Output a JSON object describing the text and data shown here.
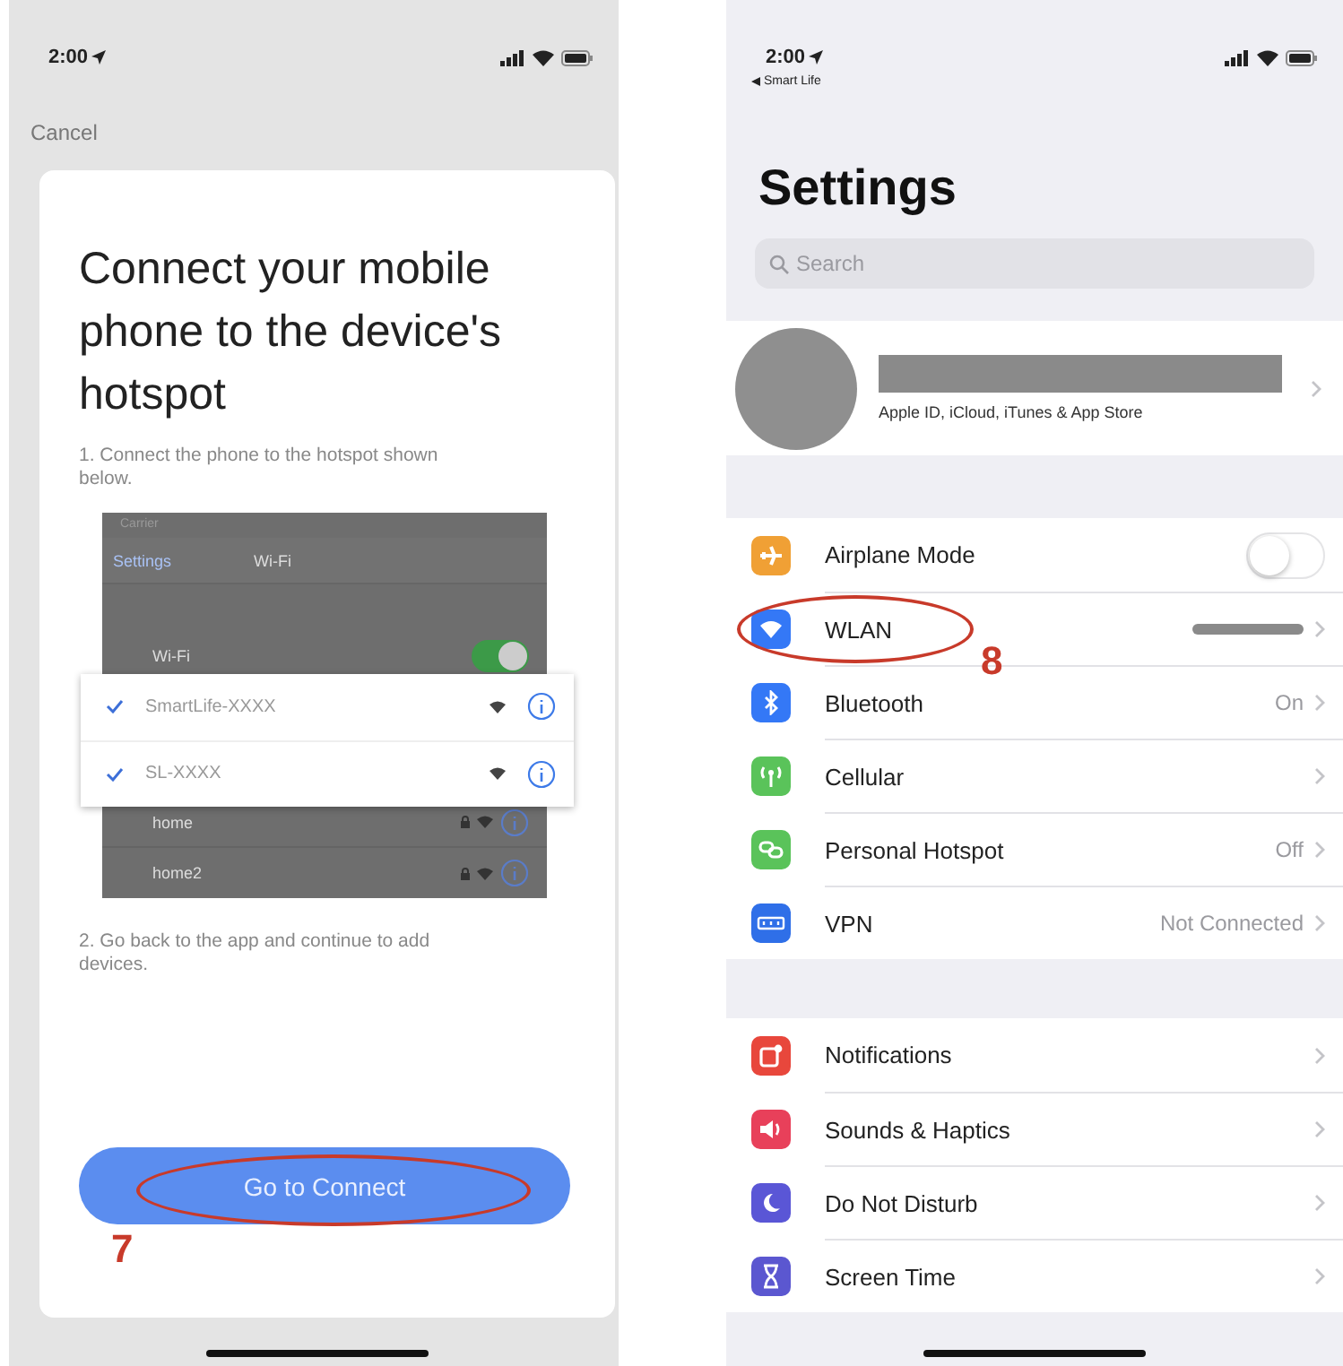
{
  "left_screen": {
    "status_bar": {
      "time": "2:00"
    },
    "cancel": "Cancel",
    "title": "Connect your mobile phone to the device's hotspot",
    "step_1": "1. Connect the phone to the hotspot shown below.",
    "wifi_example": {
      "carrier": "Carrier",
      "back": "Settings",
      "title": "Wi-Fi",
      "wifi_label": "Wi-Fi",
      "wifi_on": true,
      "highlighted_networks": [
        {
          "name": "SmartLife-XXXX",
          "checked": true
        },
        {
          "name": "SL-XXXX",
          "checked": true
        }
      ],
      "other_networks": [
        {
          "name": "home",
          "locked": true
        },
        {
          "name": "home2",
          "locked": true
        }
      ]
    },
    "step_2": "2. Go back to the app and continue to add devices.",
    "button": {
      "label": "Go to Connect",
      "annotation": "7"
    }
  },
  "right_screen": {
    "status_bar": {
      "time": "2:00",
      "back_app": "Smart Life"
    },
    "title": "Settings",
    "search": {
      "placeholder": "Search"
    },
    "profile": {
      "subtitle": "Apple ID, iCloud, iTunes & App Store"
    },
    "groups": [
      {
        "rows": [
          {
            "label": "Airplane Mode",
            "kind": "toggle",
            "on": false,
            "color": "#f0a035"
          },
          {
            "label": "WLAN",
            "kind": "masked",
            "color": "#3478f6",
            "annotation": "8"
          },
          {
            "label": "Bluetooth",
            "kind": "value",
            "value": "On",
            "color": "#3478f6"
          },
          {
            "label": "Cellular",
            "kind": "link",
            "color": "#5ac35a"
          },
          {
            "label": "Personal Hotspot",
            "kind": "value",
            "value": "Off",
            "color": "#5ac35a"
          },
          {
            "label": "VPN",
            "kind": "value",
            "value": "Not Connected",
            "color": "#2f6fe8"
          }
        ]
      },
      {
        "rows": [
          {
            "label": "Notifications",
            "kind": "link",
            "color": "#e8473c"
          },
          {
            "label": "Sounds & Haptics",
            "kind": "link",
            "color": "#e8405a"
          },
          {
            "label": "Do Not Disturb",
            "kind": "link",
            "color": "#5a56d6"
          },
          {
            "label": "Screen Time",
            "kind": "link",
            "color": "#5b57d0"
          }
        ]
      }
    ]
  }
}
